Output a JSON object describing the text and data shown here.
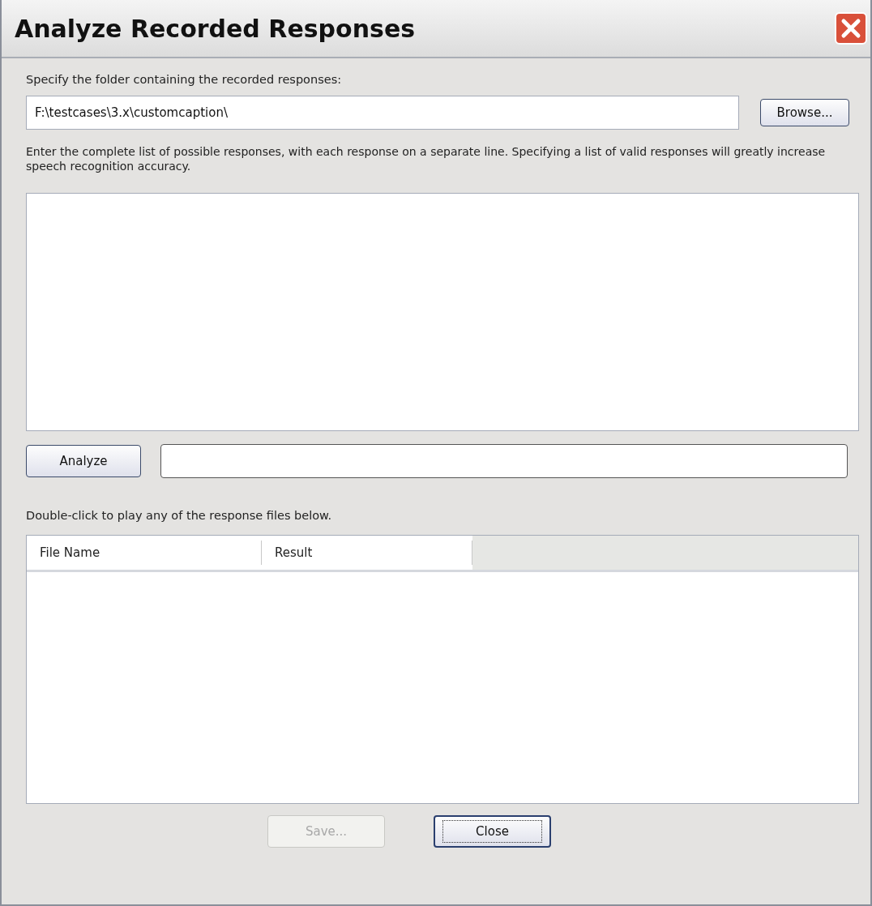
{
  "window": {
    "title": "Analyze Recorded Responses"
  },
  "folder": {
    "label": "Specify the folder containing the recorded responses:",
    "value": "F:\\testcases\\3.x\\customcaption\\",
    "browse_button": "Browse..."
  },
  "responses": {
    "instructions": "Enter the complete list of possible responses, with each response on a separate line. Specifying a list of valid responses will greatly increase speech recognition accuracy."
  },
  "analyze": {
    "button": "Analyze"
  },
  "files": {
    "hint": "Double-click to play any of the response files below.",
    "columns": [
      "File Name",
      "Result"
    ]
  },
  "buttons": [
    {
      "label": "Save...",
      "disabled": true,
      "focused": false
    },
    {
      "label": "Close",
      "disabled": false,
      "focused": true
    }
  ]
}
